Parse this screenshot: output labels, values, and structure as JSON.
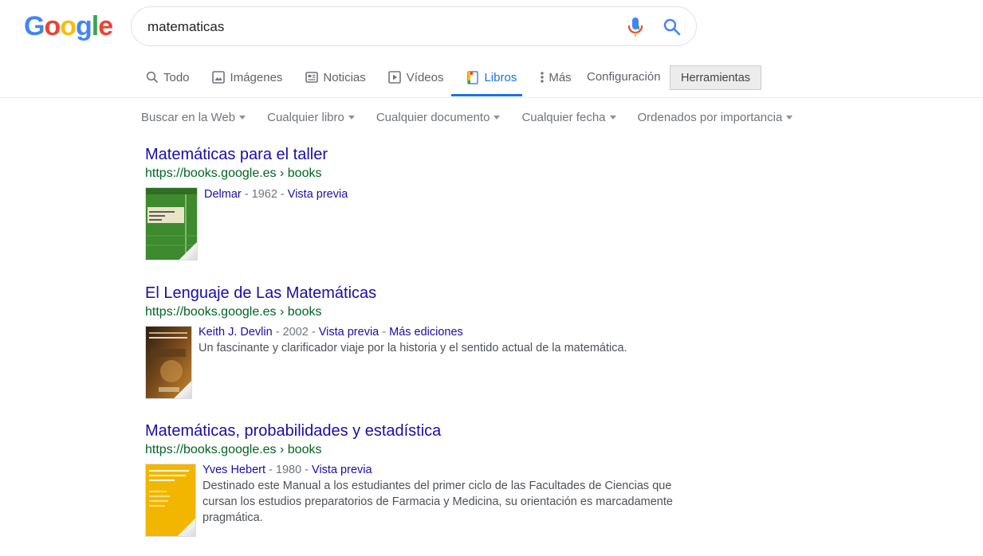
{
  "header": {
    "logo_letters": [
      "G",
      "o",
      "o",
      "g",
      "l",
      "e"
    ],
    "search_value": "matematicas"
  },
  "tabs": [
    {
      "label": "Todo",
      "icon": "search-icon"
    },
    {
      "label": "Imágenes",
      "icon": "image-icon"
    },
    {
      "label": "Noticias",
      "icon": "news-icon"
    },
    {
      "label": "Vídeos",
      "icon": "play-icon"
    },
    {
      "label": "Libros",
      "icon": "book-icon",
      "active": true
    },
    {
      "label": "Más",
      "icon": "more-vert-icon"
    }
  ],
  "settings_label": "Configuración",
  "tools_label": "Herramientas",
  "filters": [
    "Buscar en la Web",
    "Cualquier libro",
    "Cualquier documento",
    "Cualquier fecha",
    "Ordenados por importancia"
  ],
  "results": [
    {
      "title": "Matemáticas para el taller",
      "url": "https://books.google.es › books",
      "author": "Delmar",
      "year": "1962",
      "preview": "Vista previa",
      "sep": " - ",
      "cover_color": "#3e8a2e"
    },
    {
      "title": "El Lenguaje de Las Matemáticas",
      "url": "https://books.google.es › books",
      "author": "Keith J. Devlin",
      "year": "2002",
      "preview": "Vista previa",
      "editions": "Más ediciones",
      "sep": " - ",
      "description": "Un fascinante y clarificador viaje por la historia y el sentido actual de la matemática.",
      "cover_color": "#3a2a1a"
    },
    {
      "title": "Matemáticas, probabilidades y estadística",
      "url": "https://books.google.es › books",
      "author": "Yves Hebert",
      "year": "1980",
      "preview": "Vista previa",
      "sep": " - ",
      "description_lines": [
        "Destinado este Manual a los estudiantes del primer ciclo de las Facultades de Ciencias que",
        "cursan los estudios preparatorios de Farmacia y Medicina, su orientación es marcadamente",
        "pragmática."
      ],
      "cover_color": "#f2b600"
    }
  ],
  "colors": {
    "link": "#1a0dab",
    "url_green": "#006621",
    "accent_blue": "#1a73e8"
  }
}
